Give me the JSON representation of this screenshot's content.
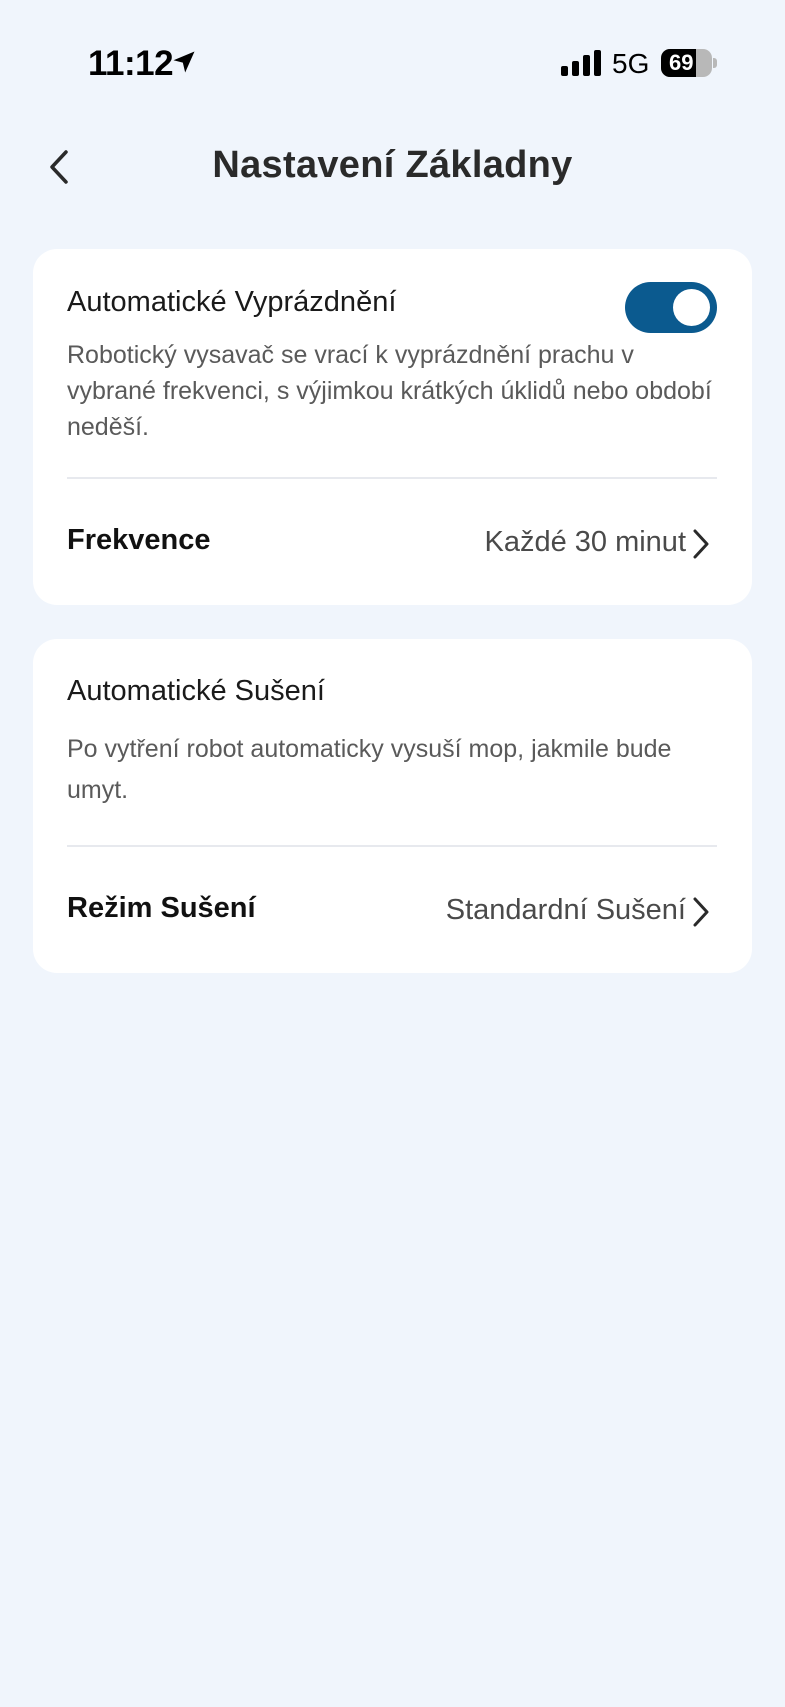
{
  "status_bar": {
    "time": "11:12",
    "network": "5G",
    "battery_level": "69",
    "battery_fraction": 0.69
  },
  "header": {
    "title": "Nastavení Základny"
  },
  "auto_empty": {
    "title": "Automatické Vyprázdnění",
    "description": "Robotický vysavač se vrací k vyprázdnění prachu v vybrané frekvenci, s výjimkou krátkých úklidů nebo období neděší.",
    "toggle_on": true,
    "toggle_color": "#0b5a8f",
    "frequency_label": "Frekvence",
    "frequency_value": "Každé 30 minut"
  },
  "auto_dry": {
    "title": "Automatické Sušení",
    "description": "Po vytření robot automaticky vysuší mop, jakmile bude umyt.",
    "mode_label": "Režim Sušení",
    "mode_value": "Standardní Sušení"
  },
  "colors": {
    "background": "#f0f5fc",
    "card": "#ffffff",
    "accent": "#0b5a8f"
  }
}
